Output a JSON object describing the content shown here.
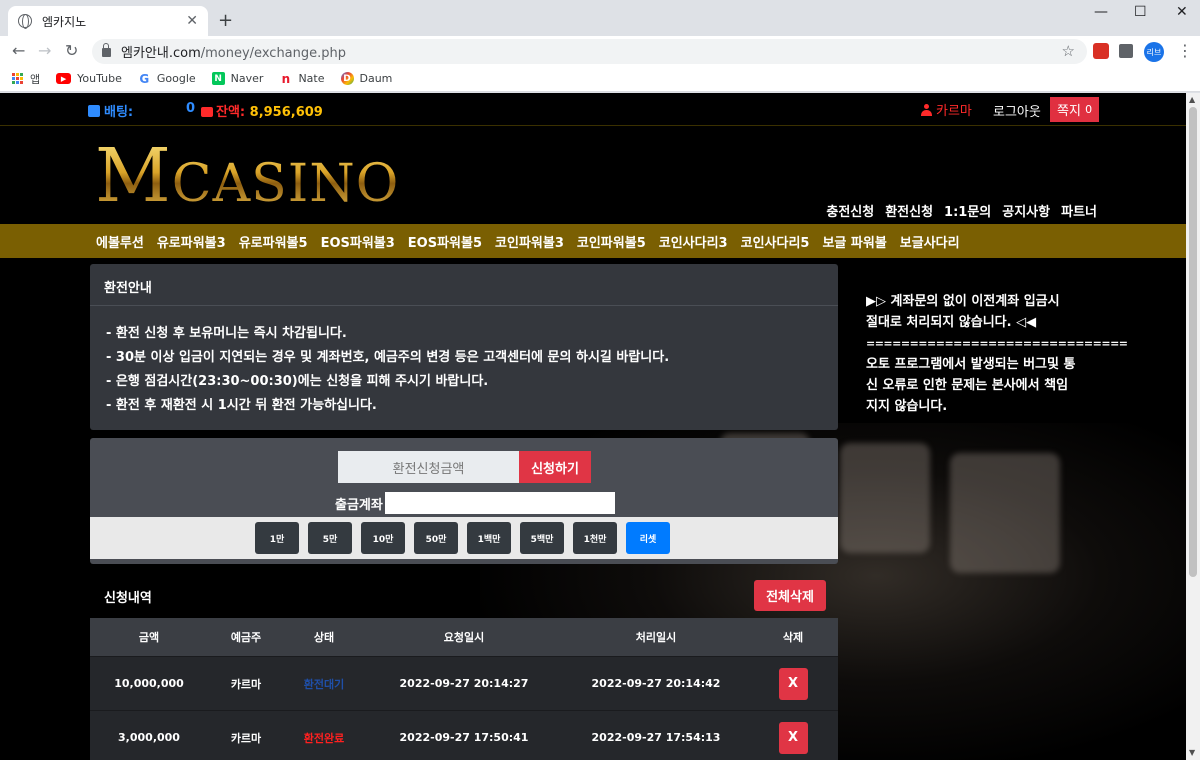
{
  "browser": {
    "tab_title": "엠카지노",
    "url_host": "엠카안내.com",
    "url_path": "/money/exchange.php",
    "profile_label": "리브",
    "bookmarks": [
      {
        "label": "앱",
        "icon": "apps-icon"
      },
      {
        "label": "YouTube",
        "icon": "youtube-icon"
      },
      {
        "label": "Google",
        "icon": "google-icon"
      },
      {
        "label": "Naver",
        "icon": "naver-icon"
      },
      {
        "label": "Nate",
        "icon": "nate-icon"
      },
      {
        "label": "Daum",
        "icon": "daum-icon"
      }
    ]
  },
  "topbar": {
    "bet_label": "배팅:",
    "bet_value": "0",
    "balance_label": "잔액:",
    "balance_value": "8,956,609",
    "username": "카르마",
    "logout": "로그아웃",
    "message_label": "쪽지",
    "message_count": "0"
  },
  "header": {
    "logo_m": "M",
    "logo_rest": "CASINO",
    "links": [
      "충전신청",
      "환전신청",
      "1:1문의",
      "공지사항",
      "파트너"
    ]
  },
  "nav": [
    "에볼루션",
    "유로파워볼3",
    "유로파워볼5",
    "EOS파워볼3",
    "EOS파워볼5",
    "코인파워볼3",
    "코인파워볼5",
    "코인사다리3",
    "코인사다리5",
    "보글 파워볼",
    "보글사다리"
  ],
  "guide": {
    "title": "환전안내",
    "lines": [
      "- 환전 신청 후 보유머니는 즉시 차감됩니다.",
      "- 30분 이상 입금이 지연되는 경우 및 계좌번호, 예금주의 변경 등은 고객센터에 문의 하시길 바랍니다.",
      "- 은행 점검시간(23:30~00:30)에는 신청을 피해 주시기 바랍니다.",
      "- 환전 후 재환전 시 1시간 뒤 환전 가능하십니다."
    ]
  },
  "notice": {
    "line1": "▶▷ 계좌문의 없이 이전계좌 입금시",
    "line2": "절대로 처리되지 않습니다. ◁◀",
    "divider": "==============================",
    "line3": "오토 프로그램에서 발생되는 버그및 통",
    "line4": "신 오류로 인한 문제는 본사에서 책임",
    "line5": "지지 않습니다."
  },
  "form": {
    "amount_placeholder": "환전신청금액",
    "apply_label": "신청하기",
    "account_label": "출금계좌",
    "quick_amounts": [
      "1만",
      "5만",
      "10만",
      "50만",
      "1백만",
      "5백만",
      "1천만"
    ],
    "reset_label": "리셋"
  },
  "history": {
    "title": "신청내역",
    "delete_all": "전체삭제",
    "columns": [
      "금액",
      "예금주",
      "상태",
      "요청일시",
      "처리일시",
      "삭제"
    ],
    "rows": [
      {
        "amount": "10,000,000",
        "holder": "카르마",
        "status": "환전대기",
        "status_type": "wait",
        "requested": "2022-09-27 20:14:27",
        "processed": "2022-09-27 20:14:42",
        "delete": "X"
      },
      {
        "amount": "3,000,000",
        "holder": "카르마",
        "status": "환전완료",
        "status_type": "done",
        "requested": "2022-09-27 17:50:41",
        "processed": "2022-09-27 17:54:13",
        "delete": "X"
      }
    ]
  },
  "colors": {
    "nav_bar": "#7a5f02",
    "accent_red": "#e03545",
    "accent_blue": "#007bff",
    "gold": "#d4a52a"
  }
}
